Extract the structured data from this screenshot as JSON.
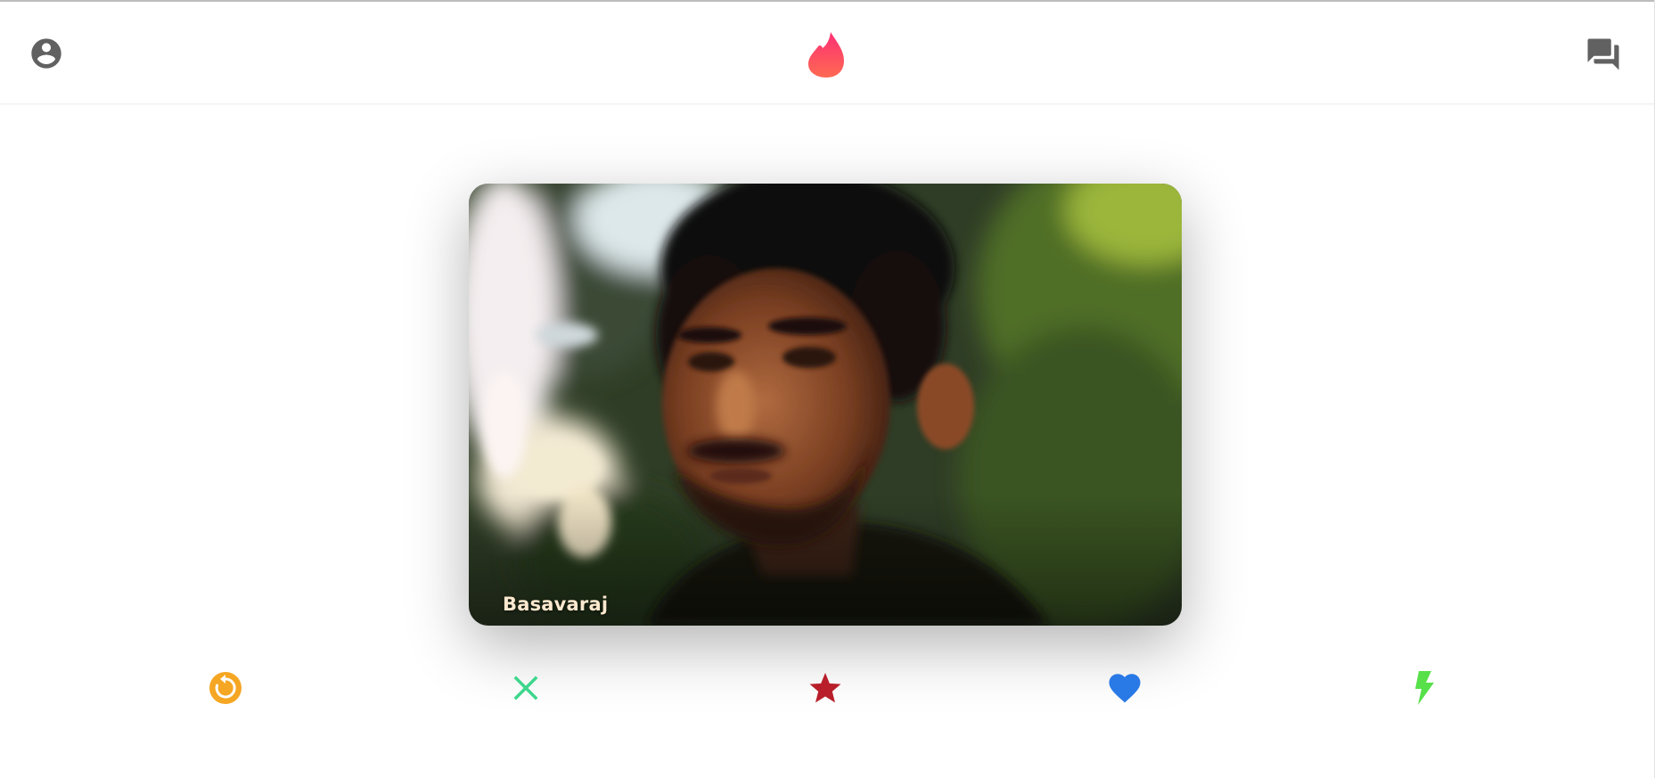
{
  "header": {
    "profile_icon": "account-circle-icon",
    "logo_icon": "tinder-flame-icon",
    "chat_icon": "forum-icon"
  },
  "card": {
    "name": "Basavaraj"
  },
  "actions": [
    {
      "icon": "replay-icon",
      "color": "#f5a623"
    },
    {
      "icon": "close-icon",
      "color": "#3dd68c"
    },
    {
      "icon": "star-icon",
      "color": "#b81f2a"
    },
    {
      "icon": "favorite-icon",
      "color": "#2979e6"
    },
    {
      "icon": "flash-icon",
      "color": "#57e04a"
    }
  ],
  "colors": {
    "icon_gray": "#616161",
    "flame_top": "#fd3f6f",
    "flame_bottom": "#fe6b54"
  }
}
